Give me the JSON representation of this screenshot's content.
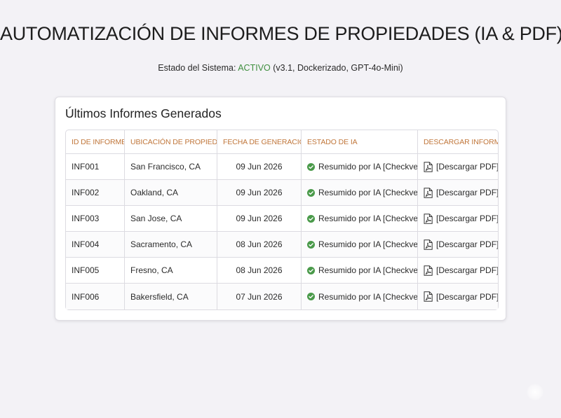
{
  "header": {
    "title": "AUTOMATIZACIÓN DE INFORMES DE PROPIEDADES (IA & PDF)"
  },
  "status": {
    "prefix": "Estado del Sistema: ",
    "state": "ACTIVO",
    "details": " (v3.1, Dockerizado, GPT-4o-Mini)",
    "state_color": "#3f8f3f"
  },
  "reports_card": {
    "title": "Últimos Informes Generados",
    "columns": [
      "ID DE INFORME",
      "UBICACIÓN DE PROPIEDAD",
      "FECHA DE GENERACIÓN",
      "ESTADO DE IA",
      "DESCARGAR INFORME"
    ],
    "header_color": "#c0763a",
    "rows": [
      {
        "id": "INF001",
        "location": "San Francisco, CA",
        "date": "09 Jun 2026",
        "ai_status": "Resumido por IA [Checkverde]",
        "download": "[Descargar PDF]",
        "status_icon": "check-circle-icon",
        "download_icon": "pdf-file-icon"
      },
      {
        "id": "INF002",
        "location": "Oakland, CA",
        "date": "09 Jun 2026",
        "ai_status": "Resumido por IA [Checkverde]",
        "download": "[Descargar PDF]",
        "status_icon": "check-circle-icon",
        "download_icon": "pdf-file-icon"
      },
      {
        "id": "INF003",
        "location": "San Jose, CA",
        "date": "09 Jun 2026",
        "ai_status": "Resumido por IA [Checkverde]",
        "download": "[Descargar PDF]",
        "status_icon": "check-circle-icon",
        "download_icon": "pdf-file-icon"
      },
      {
        "id": "INF004",
        "location": "Sacramento, CA",
        "date": "08 Jun 2026",
        "ai_status": "Resumido por IA [Checkverde]",
        "download": "[Descargar PDF]",
        "status_icon": "check-circle-icon",
        "download_icon": "pdf-file-icon"
      },
      {
        "id": "INF005",
        "location": "Fresno, CA",
        "date": "08 Jun 2026",
        "ai_status": "Resumido por IA [Checkverde]",
        "download": "[Descargar PDF]",
        "status_icon": "check-circle-icon",
        "download_icon": "pdf-file-icon"
      },
      {
        "id": "INF006",
        "location": "Bakersfield, CA",
        "date": "07 Jun 2026",
        "ai_status": "Resumido por IA [Checkverde]",
        "download": "[Descargar PDF]",
        "status_icon": "check-circle-icon",
        "download_icon": "pdf-file-icon"
      }
    ],
    "check_color": "#4a9a4a"
  }
}
